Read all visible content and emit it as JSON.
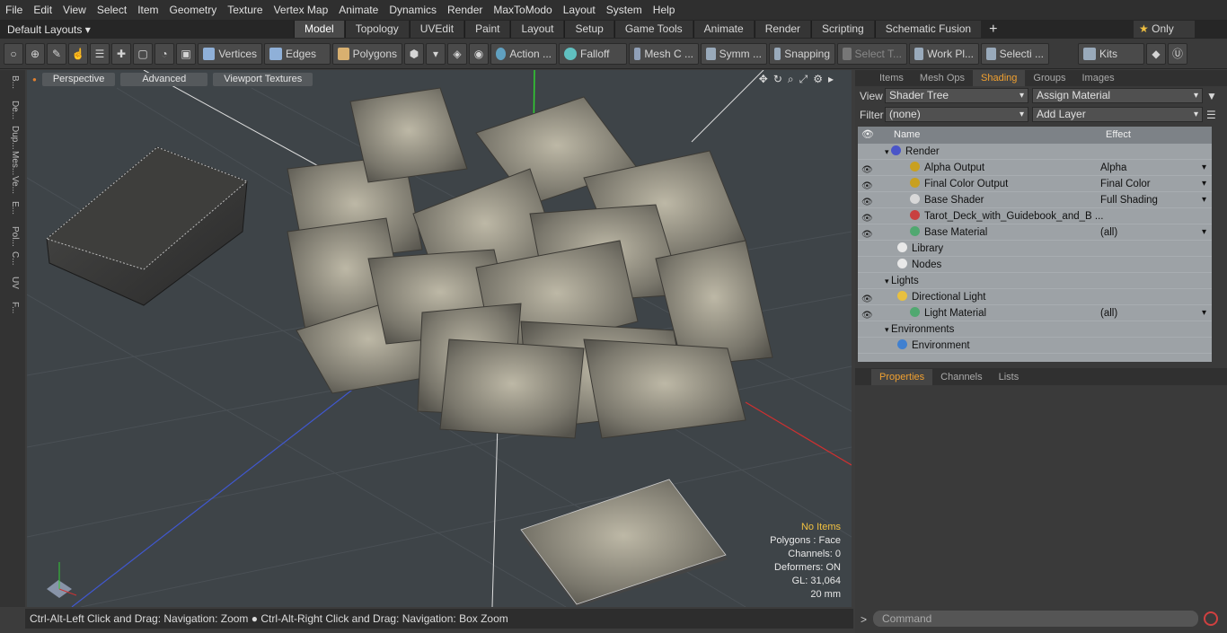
{
  "menu": [
    "File",
    "Edit",
    "View",
    "Select",
    "Item",
    "Geometry",
    "Texture",
    "Vertex Map",
    "Animate",
    "Dynamics",
    "Render",
    "MaxToModo",
    "Layout",
    "System",
    "Help"
  ],
  "layout_selector": "Default Layouts",
  "tabs": [
    "Model",
    "Topology",
    "UVEdit",
    "Paint",
    "Layout",
    "Setup",
    "Game Tools",
    "Animate",
    "Render",
    "Scripting",
    "Schematic Fusion"
  ],
  "only_label": "Only",
  "toolbar": {
    "vertices": "Vertices",
    "edges": "Edges",
    "polygons": "Polygons",
    "action": "Action ...",
    "falloff": "Falloff",
    "mesh": "Mesh C ...",
    "symm": "Symm ...",
    "snapping": "Snapping",
    "select_t": "Select T...",
    "work_pl": "Work Pl...",
    "selecti": "Selecti ...",
    "kits": "Kits"
  },
  "left_tabs": [
    "B...",
    "De...",
    "Dup...",
    "Mes...",
    "Ve...",
    "E...",
    "Pol...",
    "C...",
    "UV",
    "F..."
  ],
  "viewport": {
    "perspective": "Perspective",
    "advanced": "Advanced",
    "textures": "Viewport Textures",
    "info": {
      "items": "No Items",
      "polygons": "Polygons : Face",
      "channels": "Channels: 0",
      "deformers": "Deformers: ON",
      "gl": "GL: 31,064",
      "unit": "20 mm"
    }
  },
  "status": "Ctrl-Alt-Left Click and Drag: Navigation: Zoom ● Ctrl-Alt-Right Click and Drag: Navigation: Box Zoom",
  "panel": {
    "tabs": [
      "Items",
      "Mesh Ops",
      "Shading",
      "Groups",
      "Images"
    ],
    "view_label": "View",
    "view_value": "Shader Tree",
    "assign": "Assign Material",
    "filter_label": "Filter",
    "filter_value": "(none)",
    "add_layer": "Add Layer",
    "col_name": "Name",
    "col_effect": "Effect",
    "rows": [
      {
        "name": "Render",
        "effect": "",
        "indent": 0,
        "icon": "#4a55c8",
        "eye": false
      },
      {
        "name": "Alpha Output",
        "effect": "Alpha",
        "indent": 2,
        "icon": "#c8a020",
        "eye": true
      },
      {
        "name": "Final Color Output",
        "effect": "Final Color",
        "indent": 2,
        "icon": "#c8a020",
        "eye": true
      },
      {
        "name": "Base Shader",
        "effect": "Full Shading",
        "indent": 2,
        "icon": "#d8d8d8",
        "eye": true
      },
      {
        "name": "Tarot_Deck_with_Guidebook_and_B ...",
        "effect": "",
        "indent": 2,
        "icon": "#c84040",
        "eye": true
      },
      {
        "name": "Base Material",
        "effect": "(all)",
        "indent": 2,
        "icon": "#50a870",
        "eye": true
      },
      {
        "name": "Library",
        "effect": "",
        "indent": 1,
        "icon": "#e8e8e8",
        "eye": false
      },
      {
        "name": "Nodes",
        "effect": "",
        "indent": 1,
        "icon": "#e8e8e8",
        "eye": false
      },
      {
        "name": "Lights",
        "effect": "",
        "indent": 0,
        "icon": "",
        "eye": false
      },
      {
        "name": "Directional Light",
        "effect": "",
        "indent": 1,
        "icon": "#e8c040",
        "eye": true
      },
      {
        "name": "Light Material",
        "effect": "(all)",
        "indent": 2,
        "icon": "#50a870",
        "eye": true
      },
      {
        "name": "Environments",
        "effect": "",
        "indent": 0,
        "icon": "",
        "eye": false
      },
      {
        "name": "Environment",
        "effect": "",
        "indent": 1,
        "icon": "#4080d0",
        "eye": false
      }
    ],
    "lower_tabs": [
      "Properties",
      "Channels",
      "Lists"
    ],
    "command": "Command"
  }
}
